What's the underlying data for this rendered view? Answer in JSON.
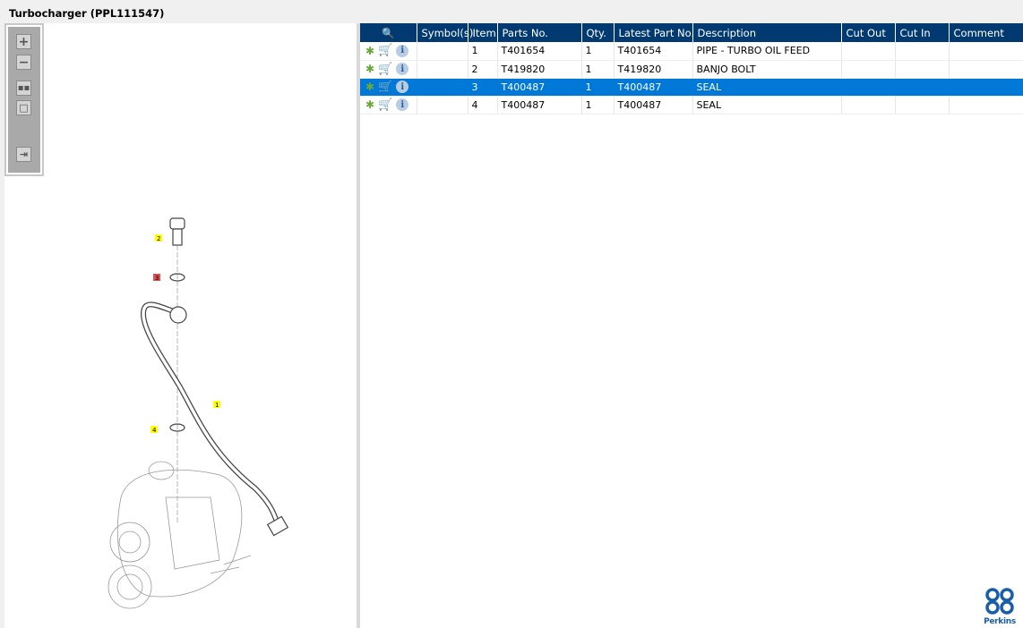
{
  "title": "Turbocharger (PPL111547)",
  "toolbar": {
    "zoom_in": "zoom-in",
    "zoom_out": "zoom-out",
    "fit": "fit",
    "actual": "actual-size",
    "export": "export"
  },
  "table": {
    "headers": [
      "Symbol(s)",
      "Item",
      "Parts No.",
      "Qty.",
      "Latest Part No.",
      "Description",
      "Cut Out",
      "Cut In",
      "Comment"
    ],
    "rows": [
      {
        "symbols": "",
        "item": "1",
        "part": "T401654",
        "qty": "1",
        "latest": "T401654",
        "desc": "PIPE - TURBO OIL FEED",
        "cut_out": "",
        "cut_in": "",
        "comment": ""
      },
      {
        "symbols": "",
        "item": "2",
        "part": "T419820",
        "qty": "1",
        "latest": "T419820",
        "desc": "BANJO BOLT",
        "cut_out": "",
        "cut_in": "",
        "comment": ""
      },
      {
        "symbols": "",
        "item": "3",
        "part": "T400487",
        "qty": "1",
        "latest": "T400487",
        "desc": "SEAL",
        "cut_out": "",
        "cut_in": "",
        "comment": ""
      },
      {
        "symbols": "",
        "item": "4",
        "part": "T400487",
        "qty": "1",
        "latest": "T400487",
        "desc": "SEAL",
        "cut_out": "",
        "cut_in": "",
        "comment": ""
      }
    ],
    "selected_index": 2
  },
  "diagram": {
    "callouts": [
      "1",
      "2",
      "3",
      "4"
    ],
    "selected_callout": "3",
    "callout_color": "#ffff00",
    "selected_color": "#e05050"
  },
  "brand": {
    "name": "Perkins",
    "color": "#1a5ea8"
  }
}
